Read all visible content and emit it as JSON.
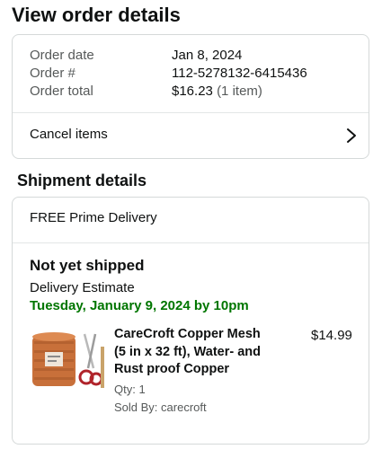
{
  "page_title": "View order details",
  "order": {
    "rows": [
      {
        "label": "Order date",
        "value": "Jan 8, 2024"
      },
      {
        "label": "Order #",
        "value": "112-5278132-6415436"
      },
      {
        "label": "Order total",
        "value": "$16.23",
        "note": "(1 item)"
      }
    ],
    "cancel_label": "Cancel items",
    "cancel_icon": "chevron-right-icon"
  },
  "shipment": {
    "section_title": "Shipment details",
    "delivery_type": "FREE Prime Delivery",
    "status": "Not yet shipped",
    "estimate_label": "Delivery Estimate",
    "estimate_date": "Tuesday, January 9, 2024 by 10pm",
    "estimate_color": "#007600",
    "item": {
      "title_lines": [
        "CareCroft Copper Mesh",
        "(5 in x 32 ft), Water- and",
        "Rust proof Copper"
      ],
      "price": "$14.99",
      "qty": "Qty: 1",
      "seller": "Sold By: carecroft",
      "image_icon": "copper-mesh-roll-product-image"
    }
  }
}
